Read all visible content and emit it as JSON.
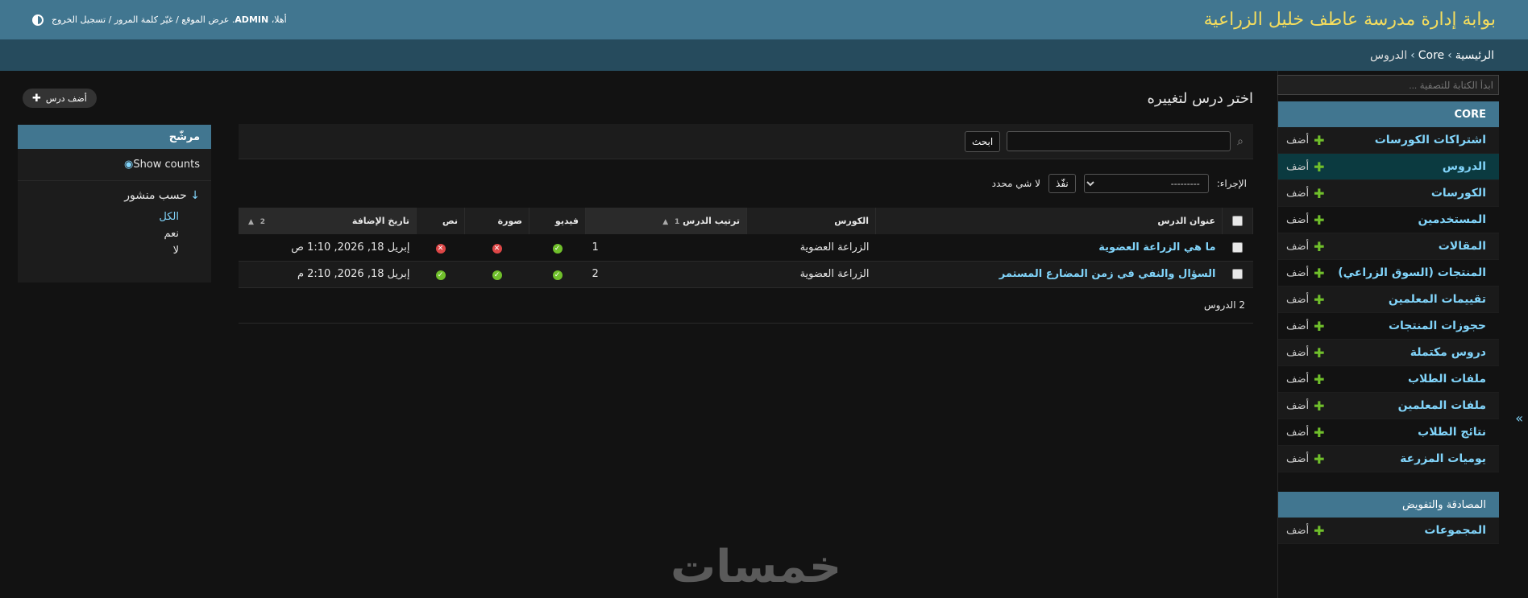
{
  "header": {
    "site_title": "بوابة إدارة مدرسة عاطف خليل الزراعية",
    "welcome": "أهلا،",
    "username": "ADMIN",
    "view_site": "عرض الموقع",
    "change_password": "غيّر كلمة المرور",
    "logout": "تسجيل الخروج",
    "separator": "/"
  },
  "breadcrumbs": {
    "home": "الرئيسية",
    "app": "Core",
    "current": "الدروس",
    "sep": "›"
  },
  "sidebar": {
    "filter_placeholder": "ابدأ الكتابة للتصفية ...",
    "add_label": "أضف",
    "core_caption": "CORE",
    "core_models": [
      {
        "name": "اشتراكات الكورسات",
        "current": false
      },
      {
        "name": "الدروس",
        "current": true
      },
      {
        "name": "الكورسات",
        "current": false
      },
      {
        "name": "المستخدمين",
        "current": false
      },
      {
        "name": "المقالات",
        "current": false
      },
      {
        "name": "المنتجات (السوق الزراعي)",
        "current": false
      },
      {
        "name": "تقييمات المعلمين",
        "current": false
      },
      {
        "name": "حجوزات المنتجات",
        "current": false
      },
      {
        "name": "دروس مكتملة",
        "current": false
      },
      {
        "name": "ملفات الطلاب",
        "current": false
      },
      {
        "name": "ملفات المعلمين",
        "current": false
      },
      {
        "name": "نتائج الطلاب",
        "current": false
      },
      {
        "name": "يوميات المزرعة",
        "current": false
      }
    ],
    "auth_caption": "المصادقة والتفويض",
    "auth_models": [
      {
        "name": "المجموعات"
      }
    ],
    "toggle": "«"
  },
  "main": {
    "page_title": "اختر درس لتغييره",
    "add_button": "أضف درس",
    "search_button": "ابحث",
    "action_label": "الإجراء:",
    "action_selected": "---------",
    "go_button": "نفّذ",
    "selected_count": "لا شي محدد",
    "columns": {
      "title": "عنوان الدرس",
      "course": "الكورس",
      "order": "ترتيب الدرس",
      "order_sort": "1",
      "video": "فيديو",
      "image": "صورة",
      "text": "نص",
      "date": "تاريخ الإضافة",
      "date_sort": "2"
    },
    "rows": [
      {
        "title": "ما هي الزراعة العضوية",
        "course": "الزراعة العضوية",
        "order": "1",
        "video": true,
        "image": false,
        "text": false,
        "date": "إبريل 18, 2026, 1:10 ص"
      },
      {
        "title": "السؤال والنفي في زمن المضارع المستمر",
        "course": "الزراعة العضوية",
        "order": "2",
        "video": true,
        "image": true,
        "text": true,
        "date": "إبريل 18, 2026, 2:10 م"
      }
    ],
    "paginator": "2 الدروس"
  },
  "filter": {
    "heading": "مرشّح",
    "show_counts": "Show counts",
    "by_published": "حسب منشور",
    "options": [
      "الكل",
      "نعم",
      "لا"
    ],
    "selected": "الكل"
  },
  "watermark": "خمسات"
}
